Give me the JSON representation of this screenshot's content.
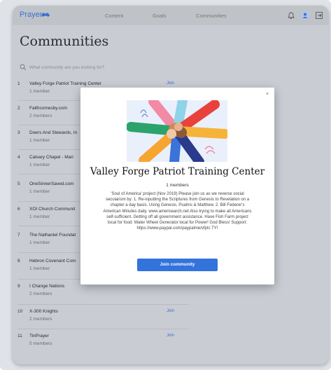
{
  "nav": {
    "brand": "Prayer",
    "links": [
      "Content",
      "Goals",
      "Communities"
    ]
  },
  "page": {
    "title": "Communities",
    "search_placeholder": "What community are you looking for?"
  },
  "communities": [
    {
      "index": "1",
      "name": "Valley Forge Patriot Training Center",
      "count": "1 member",
      "join": "Join"
    },
    {
      "index": "2",
      "name": "Faithcomesby.com",
      "count": "2 members",
      "join": ""
    },
    {
      "index": "3",
      "name": "Doers And Stewards, In",
      "count": "1 member",
      "join": ""
    },
    {
      "index": "4",
      "name": "Calvary Chapel - Mari",
      "count": "1 member",
      "join": ""
    },
    {
      "index": "5",
      "name": "OneSinnerSaved.com",
      "count": "1 member",
      "join": ""
    },
    {
      "index": "6",
      "name": "XOI Church Communit",
      "count": "1 member",
      "join": ""
    },
    {
      "index": "7",
      "name": "The Nathaniel Foundat",
      "count": "1 member",
      "join": ""
    },
    {
      "index": "8",
      "name": "Hebron Covenant Com",
      "count": "1 member",
      "join": ""
    },
    {
      "index": "9",
      "name": "I Change Nations",
      "count": "2 members",
      "join": ""
    },
    {
      "index": "10",
      "name": "X-300 Knights",
      "count": "2 members",
      "join": "Join"
    },
    {
      "index": "11",
      "name": "TinPrayer",
      "count": "5 members",
      "join": "Join"
    }
  ],
  "modal": {
    "close": "×",
    "title": "Valley Forge Patriot Training Center",
    "members": "1 members",
    "description": "'Soul of America' project (Nov 2019) Please join us as we reverse social secularism by: 1. Re-inputting the Scriptures from Genesis to Revelation on a chapter a day basis. Using Genesis, Psalms & Matthew. 2. Bill Federer's American Minutes daily. www.amerisearch.net Also trying to make all Americans self-sufficient. Getting off all government assistance. Have Fish Farm project local for food: Water Wheel Generator local for Power! God Bless! Support: https://www.paypal.com/paypalme/vfptc TY!",
    "join_label": "Join community"
  },
  "colors": {
    "accent": "#3273dc",
    "overlay": "#c9cdd3"
  }
}
